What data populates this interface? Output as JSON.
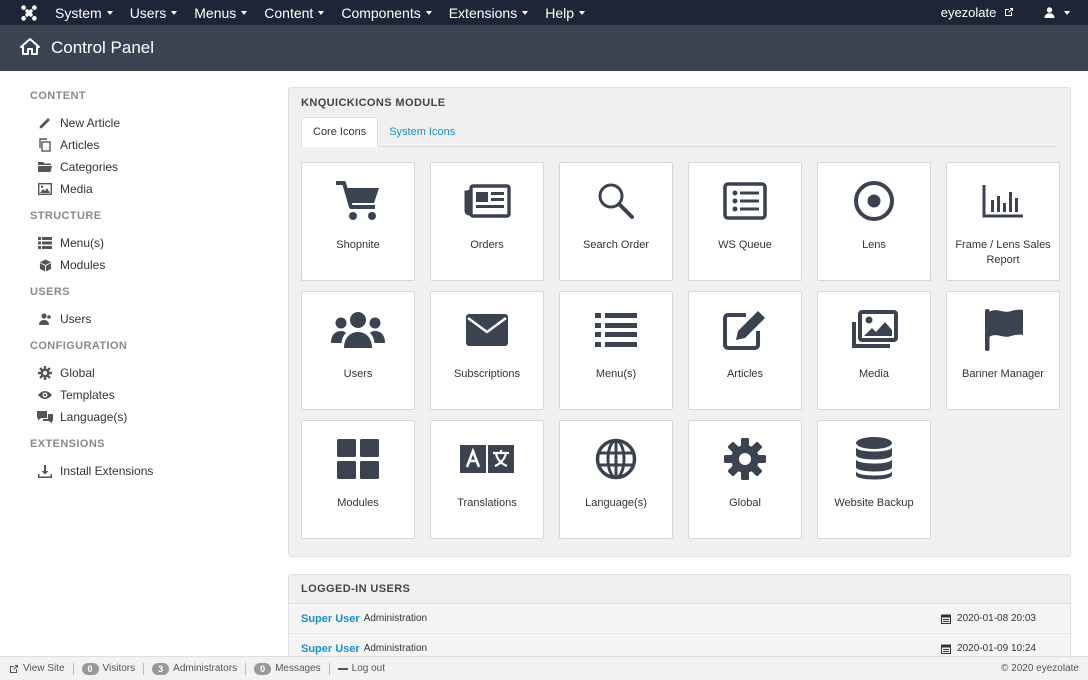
{
  "nav": {
    "menus": [
      "System",
      "Users",
      "Menus",
      "Content",
      "Components",
      "Extensions",
      "Help"
    ],
    "username": "eyezolate"
  },
  "header": {
    "title": "Control Panel"
  },
  "sidebar": {
    "sections": [
      {
        "heading": "CONTENT",
        "items": [
          {
            "label": "New Article",
            "icon": "pencil-icon"
          },
          {
            "label": "Articles",
            "icon": "copy-icon"
          },
          {
            "label": "Categories",
            "icon": "folder-icon"
          },
          {
            "label": "Media",
            "icon": "image-icon"
          }
        ]
      },
      {
        "heading": "STRUCTURE",
        "items": [
          {
            "label": "Menu(s)",
            "icon": "list-icon"
          },
          {
            "label": "Modules",
            "icon": "cube-icon"
          }
        ]
      },
      {
        "heading": "USERS",
        "items": [
          {
            "label": "Users",
            "icon": "users-icon"
          }
        ]
      },
      {
        "heading": "CONFIGURATION",
        "items": [
          {
            "label": "Global",
            "icon": "gear-icon"
          },
          {
            "label": "Templates",
            "icon": "eye-icon"
          },
          {
            "label": "Language(s)",
            "icon": "comments-icon"
          }
        ]
      },
      {
        "heading": "EXTENSIONS",
        "items": [
          {
            "label": "Install Extensions",
            "icon": "download-icon"
          }
        ]
      }
    ]
  },
  "module": {
    "title": "KNQUICKICONS MODULE",
    "tabs": [
      "Core Icons",
      "System Icons"
    ],
    "icons": [
      {
        "label": "Shopnite",
        "icon": "cart-icon"
      },
      {
        "label": "Orders",
        "icon": "newspaper-icon"
      },
      {
        "label": "Search Order",
        "icon": "search-icon"
      },
      {
        "label": "WS Queue",
        "icon": "list-alt-icon"
      },
      {
        "label": "Lens",
        "icon": "dot-circle-icon"
      },
      {
        "label": "Frame / Lens Sales Report",
        "icon": "bar-chart-icon"
      },
      {
        "label": "Users",
        "icon": "users-icon"
      },
      {
        "label": "Subscriptions",
        "icon": "envelope-icon"
      },
      {
        "label": "Menu(s)",
        "icon": "list-icon"
      },
      {
        "label": "Articles",
        "icon": "edit-icon"
      },
      {
        "label": "Media",
        "icon": "images-icon"
      },
      {
        "label": "Banner Manager",
        "icon": "flag-icon"
      },
      {
        "label": "Modules",
        "icon": "grid-icon"
      },
      {
        "label": "Translations",
        "icon": "language-icon"
      },
      {
        "label": "Language(s)",
        "icon": "globe-icon"
      },
      {
        "label": "Global",
        "icon": "gear-icon"
      },
      {
        "label": "Website Backup",
        "icon": "database-icon"
      }
    ]
  },
  "logged_in": {
    "title": "LOGGED-IN USERS",
    "rows": [
      {
        "name": "Super User",
        "area": "Administration",
        "date": "2020-01-08 20:03"
      },
      {
        "name": "Super User",
        "area": "Administration",
        "date": "2020-01-09 10:24"
      }
    ]
  },
  "statusbar": {
    "view_site": "View Site",
    "visitors_count": "0",
    "visitors_label": "Visitors",
    "admins_count": "3",
    "admins_label": "Administrators",
    "messages_count": "0",
    "messages_label": "Messages",
    "logout": "Log out",
    "copyright": "© 2020 eyezolate"
  }
}
